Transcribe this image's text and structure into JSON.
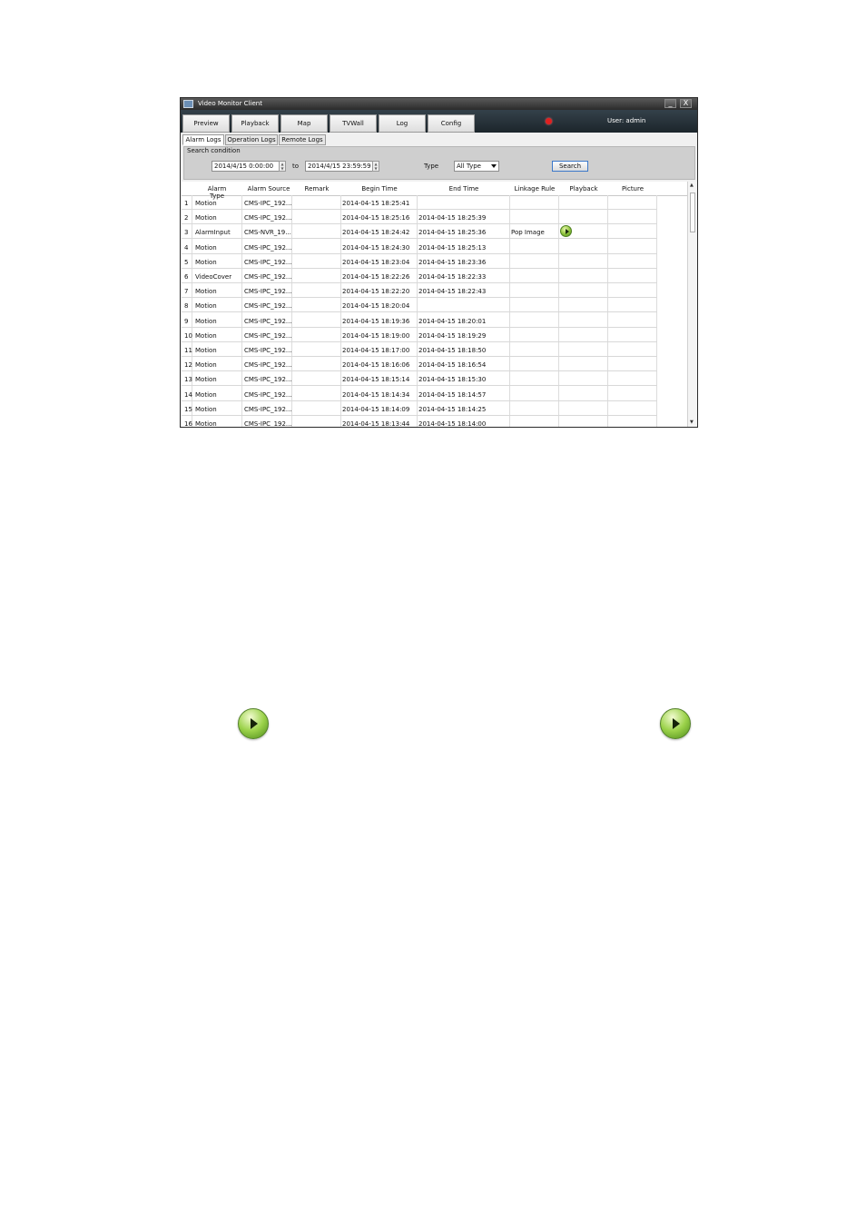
{
  "window": {
    "title": "Video Monitor Client",
    "minimize": "_",
    "close": "X"
  },
  "menu": {
    "tabs": [
      "Preview",
      "Playback",
      "Map",
      "TVWall",
      "Log",
      "Config"
    ],
    "user": "User: admin"
  },
  "subtabs": [
    "Alarm Logs",
    "Operation Logs",
    "Remote Logs"
  ],
  "search": {
    "section_label": "Search condition",
    "start": "2014/4/15 0:00:00",
    "to": "to",
    "end": "2014/4/15 23:59:59",
    "type_label": "Type",
    "type_value": "All Type",
    "button": "Search"
  },
  "table": {
    "columns": [
      "Alarm Type",
      "Alarm Source",
      "Remark",
      "Begin Time",
      "End Time",
      "Linkage Rule",
      "Playback",
      "Picture"
    ],
    "rows": [
      {
        "no": "1",
        "type": "Motion",
        "source": "CMS-IPC_192...",
        "begin": "2014-04-15 18:25:41",
        "end": "",
        "rule": ""
      },
      {
        "no": "2",
        "type": "Motion",
        "source": "CMS-IPC_192...",
        "begin": "2014-04-15 18:25:16",
        "end": "2014-04-15 18:25:39",
        "rule": ""
      },
      {
        "no": "3",
        "type": "AlarmInput",
        "source": "CMS-NVR_19...",
        "begin": "2014-04-15 18:24:42",
        "end": "2014-04-15 18:25:36",
        "rule": "Pop Image"
      },
      {
        "no": "4",
        "type": "Motion",
        "source": "CMS-IPC_192...",
        "begin": "2014-04-15 18:24:30",
        "end": "2014-04-15 18:25:13",
        "rule": ""
      },
      {
        "no": "5",
        "type": "Motion",
        "source": "CMS-IPC_192...",
        "begin": "2014-04-15 18:23:04",
        "end": "2014-04-15 18:23:36",
        "rule": ""
      },
      {
        "no": "6",
        "type": "VideoCover",
        "source": "CMS-IPC_192...",
        "begin": "2014-04-15 18:22:26",
        "end": "2014-04-15 18:22:33",
        "rule": ""
      },
      {
        "no": "7",
        "type": "Motion",
        "source": "CMS-IPC_192...",
        "begin": "2014-04-15 18:22:20",
        "end": "2014-04-15 18:22:43",
        "rule": ""
      },
      {
        "no": "8",
        "type": "Motion",
        "source": "CMS-IPC_192...",
        "begin": "2014-04-15 18:20:04",
        "end": "",
        "rule": ""
      },
      {
        "no": "9",
        "type": "Motion",
        "source": "CMS-IPC_192...",
        "begin": "2014-04-15 18:19:36",
        "end": "2014-04-15 18:20:01",
        "rule": ""
      },
      {
        "no": "10",
        "type": "Motion",
        "source": "CMS-IPC_192...",
        "begin": "2014-04-15 18:19:00",
        "end": "2014-04-15 18:19:29",
        "rule": ""
      },
      {
        "no": "11",
        "type": "Motion",
        "source": "CMS-IPC_192...",
        "begin": "2014-04-15 18:17:00",
        "end": "2014-04-15 18:18:50",
        "rule": ""
      },
      {
        "no": "12",
        "type": "Motion",
        "source": "CMS-IPC_192...",
        "begin": "2014-04-15 18:16:06",
        "end": "2014-04-15 18:16:54",
        "rule": ""
      },
      {
        "no": "13",
        "type": "Motion",
        "source": "CMS-IPC_192...",
        "begin": "2014-04-15 18:15:14",
        "end": "2014-04-15 18:15:30",
        "rule": ""
      },
      {
        "no": "14",
        "type": "Motion",
        "source": "CMS-IPC_192...",
        "begin": "2014-04-15 18:14:34",
        "end": "2014-04-15 18:14:57",
        "rule": ""
      },
      {
        "no": "15",
        "type": "Motion",
        "source": "CMS-IPC_192...",
        "begin": "2014-04-15 18:14:09",
        "end": "2014-04-15 18:14:25",
        "rule": ""
      },
      {
        "no": "16",
        "type": "Motion",
        "source": "CMS-IPC_192...",
        "begin": "2014-04-15 18:13:44",
        "end": "2014-04-15 18:14:00",
        "rule": ""
      }
    ],
    "playback_row": 3
  },
  "icons": {
    "alarm": "alarm-bell-icon",
    "playback": "play-icon"
  }
}
